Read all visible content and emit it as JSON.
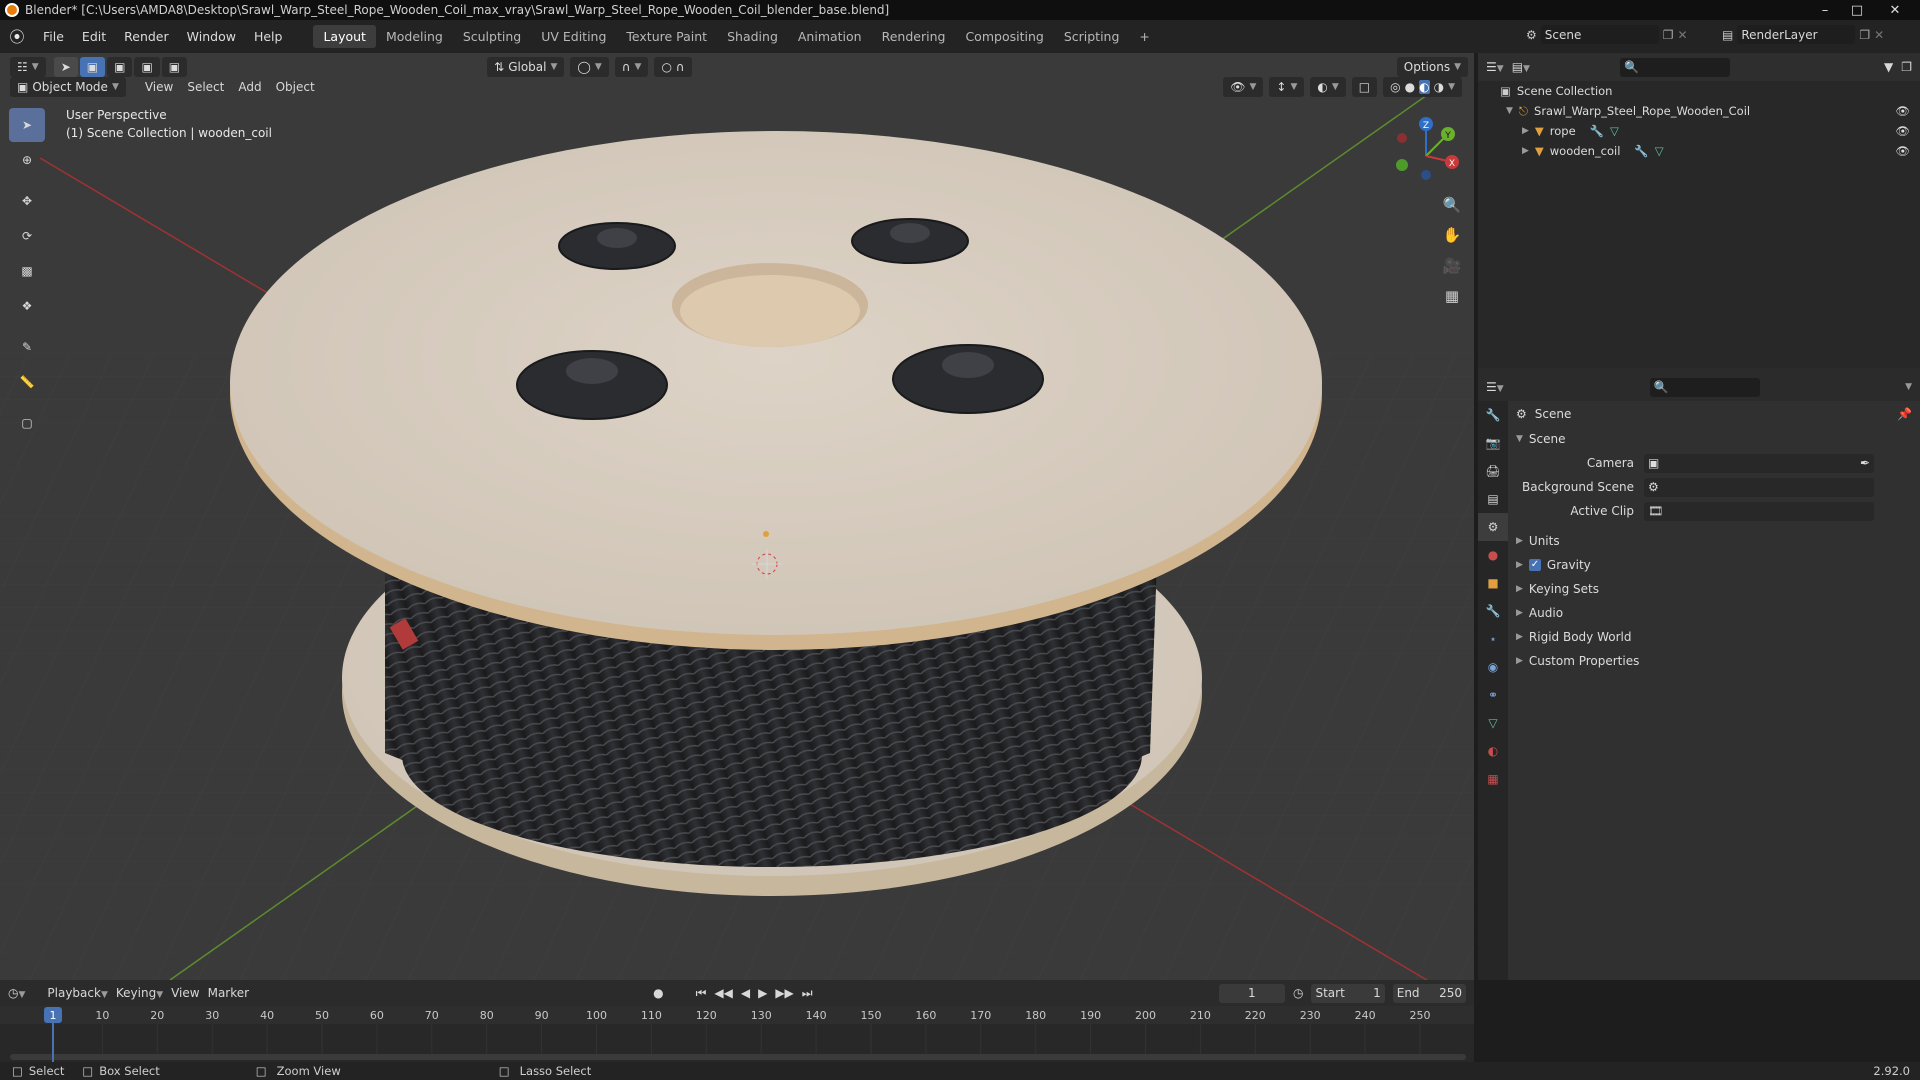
{
  "window": {
    "title": "Blender* [C:\\Users\\AMDA8\\Desktop\\Srawl_Warp_Steel_Rope_Wooden_Coil_max_vray\\Srawl_Warp_Steel_Rope_Wooden_Coil_blender_base.blend]"
  },
  "menu": {
    "items": [
      "File",
      "Edit",
      "Render",
      "Window",
      "Help"
    ]
  },
  "workspaces": [
    "Layout",
    "Modeling",
    "Sculpting",
    "UV Editing",
    "Texture Paint",
    "Shading",
    "Animation",
    "Rendering",
    "Compositing",
    "Scripting"
  ],
  "active_workspace": "Layout",
  "scene_selector": {
    "scene": "Scene",
    "view_layer": "RenderLayer"
  },
  "viewport_header": {
    "mode": "Object Mode",
    "menus": [
      "View",
      "Select",
      "Add",
      "Object"
    ],
    "orientation": "Global",
    "options": "Options"
  },
  "viewport_overlay": {
    "line1": "User Perspective",
    "line2": "(1) Scene Collection | wooden_coil"
  },
  "gizmo": {
    "x": "X",
    "y": "Y",
    "z": "Z"
  },
  "outliner": {
    "root": "Scene Collection",
    "collection": "Srawl_Warp_Steel_Rope_Wooden_Coil",
    "objects": [
      "rope",
      "wooden_coil"
    ]
  },
  "properties": {
    "header": "Scene",
    "panel": "Scene",
    "fields": [
      {
        "label": "Camera",
        "value": ""
      },
      {
        "label": "Background Scene",
        "value": ""
      },
      {
        "label": "Active Clip",
        "value": ""
      }
    ],
    "sections": [
      "Units",
      "Gravity",
      "Keying Sets",
      "Audio",
      "Rigid Body World",
      "Custom Properties"
    ],
    "gravity_checked": true
  },
  "timeline": {
    "menus": [
      "Playback",
      "Keying",
      "View",
      "Marker"
    ],
    "current_frame": "1",
    "start_label": "Start",
    "start": "1",
    "end_label": "End",
    "end": "250",
    "ticks": [
      "1",
      "10",
      "20",
      "30",
      "40",
      "50",
      "60",
      "70",
      "80",
      "90",
      "100",
      "110",
      "120",
      "130",
      "140",
      "150",
      "160",
      "170",
      "180",
      "190",
      "200",
      "210",
      "220",
      "230",
      "240",
      "250"
    ],
    "progress": 0.0
  },
  "statusbar": {
    "select": "Select",
    "box_select": "Box Select",
    "zoom_view": "Zoom View",
    "lasso_select": "Lasso Select",
    "version": "2.92.0"
  },
  "colors": {
    "accent": "#4772b3",
    "active_tool": "#5a6f9a",
    "viewport_bg": "#3b3b3b",
    "x_axis": "#c83a3a",
    "y_axis": "#6ab02e",
    "z_axis": "#2e6fc8"
  }
}
